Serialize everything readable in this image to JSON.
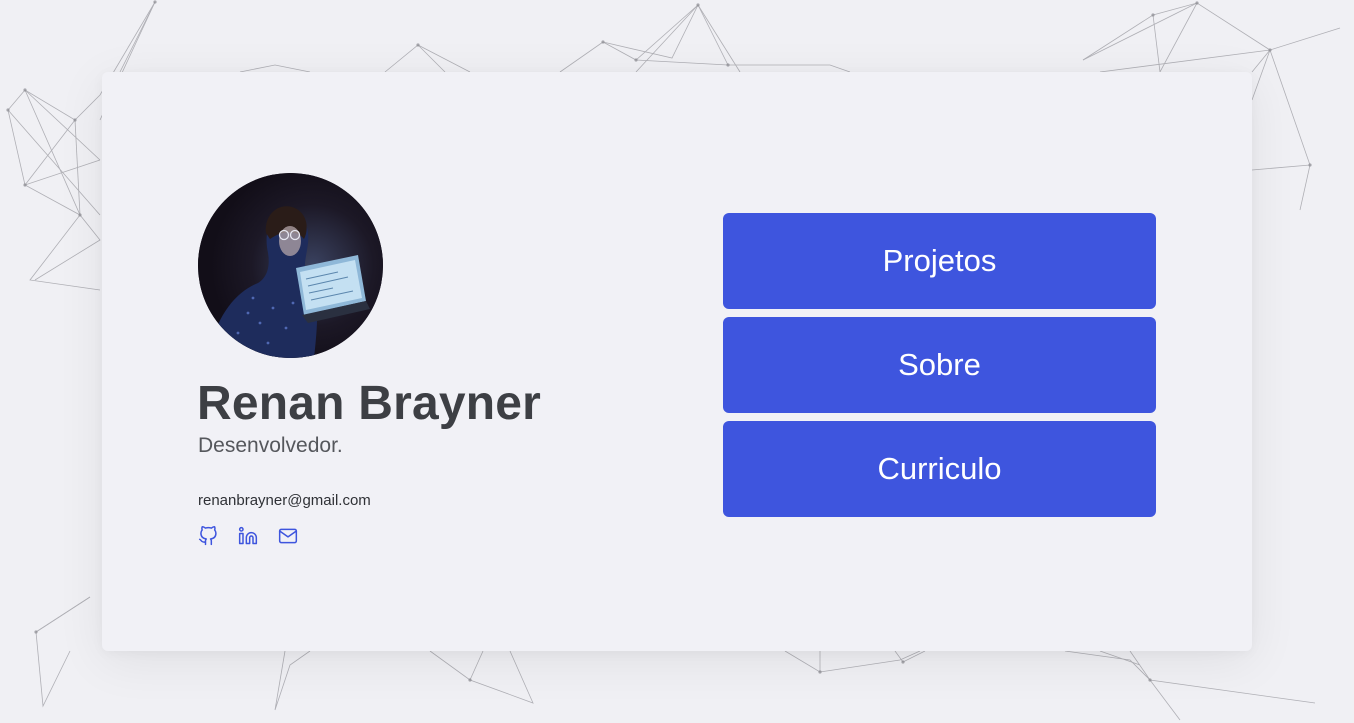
{
  "profile": {
    "name": "Renan Brayner",
    "role": "Desenvolvedor.",
    "email": "renanbrayner@gmail.com",
    "avatar_alt": "Renan Brayner"
  },
  "socials": [
    {
      "icon": "github-icon"
    },
    {
      "icon": "linkedin-icon"
    },
    {
      "icon": "mail-icon"
    }
  ],
  "nav": {
    "projects_label": "Projetos",
    "about_label": "Sobre",
    "resume_label": "Curriculo"
  },
  "colors": {
    "accent": "#3e55de",
    "background": "#f0f0f4",
    "card": "#f1f1f6",
    "text_dark": "#3d3f44",
    "network_lines": "#9a9aa0"
  }
}
